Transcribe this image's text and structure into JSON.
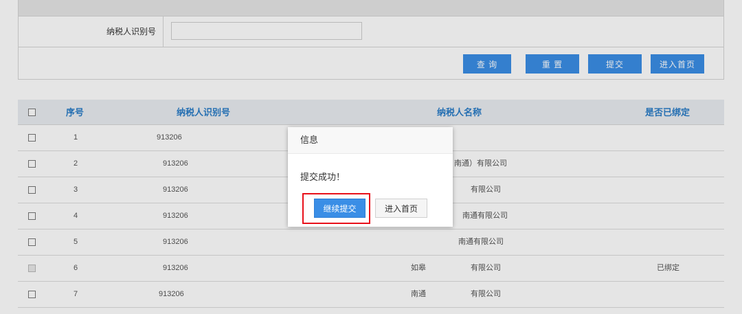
{
  "form": {
    "taxpayer_id_label": "纳税人识别号",
    "taxpayer_id_value": "",
    "buttons": {
      "query": "查 询",
      "reset": "重 置",
      "submit": "提交",
      "home": "进入首页"
    }
  },
  "table": {
    "headers": {
      "seq": "序号",
      "taxpayer_id": "纳税人识别号",
      "taxpayer_name": "纳税人名称",
      "bound": "是否已绑定"
    },
    "rows": [
      {
        "seq": "1",
        "id": "913206",
        "name": "",
        "bound": "",
        "disabled": false
      },
      {
        "seq": "2",
        "id": "913206",
        "name": "南通）有限公司",
        "bound": "",
        "disabled": false
      },
      {
        "seq": "3",
        "id": "913206",
        "name": "有限公司",
        "bound": "",
        "disabled": false
      },
      {
        "seq": "4",
        "id": "913206",
        "name": "南通有限公司",
        "bound": "",
        "disabled": false
      },
      {
        "seq": "5",
        "id": "913206",
        "name": "南通有限公司",
        "bound": "",
        "disabled": false
      },
      {
        "seq": "6",
        "id": "913206",
        "name_prefix": "如皋",
        "name": "有限公司",
        "bound": "已绑定",
        "disabled": true
      },
      {
        "seq": "7",
        "id": "913206",
        "name_prefix": "南通",
        "name": "有限公司",
        "bound": "",
        "disabled": false
      }
    ]
  },
  "dialog": {
    "title": "信息",
    "message": "提交成功！",
    "continue_button": "继续提交",
    "home_button": "进入首页"
  },
  "colors": {
    "primary": "#3a8ee6",
    "header_text": "#2a7cc7",
    "highlight": "#e8101a"
  }
}
